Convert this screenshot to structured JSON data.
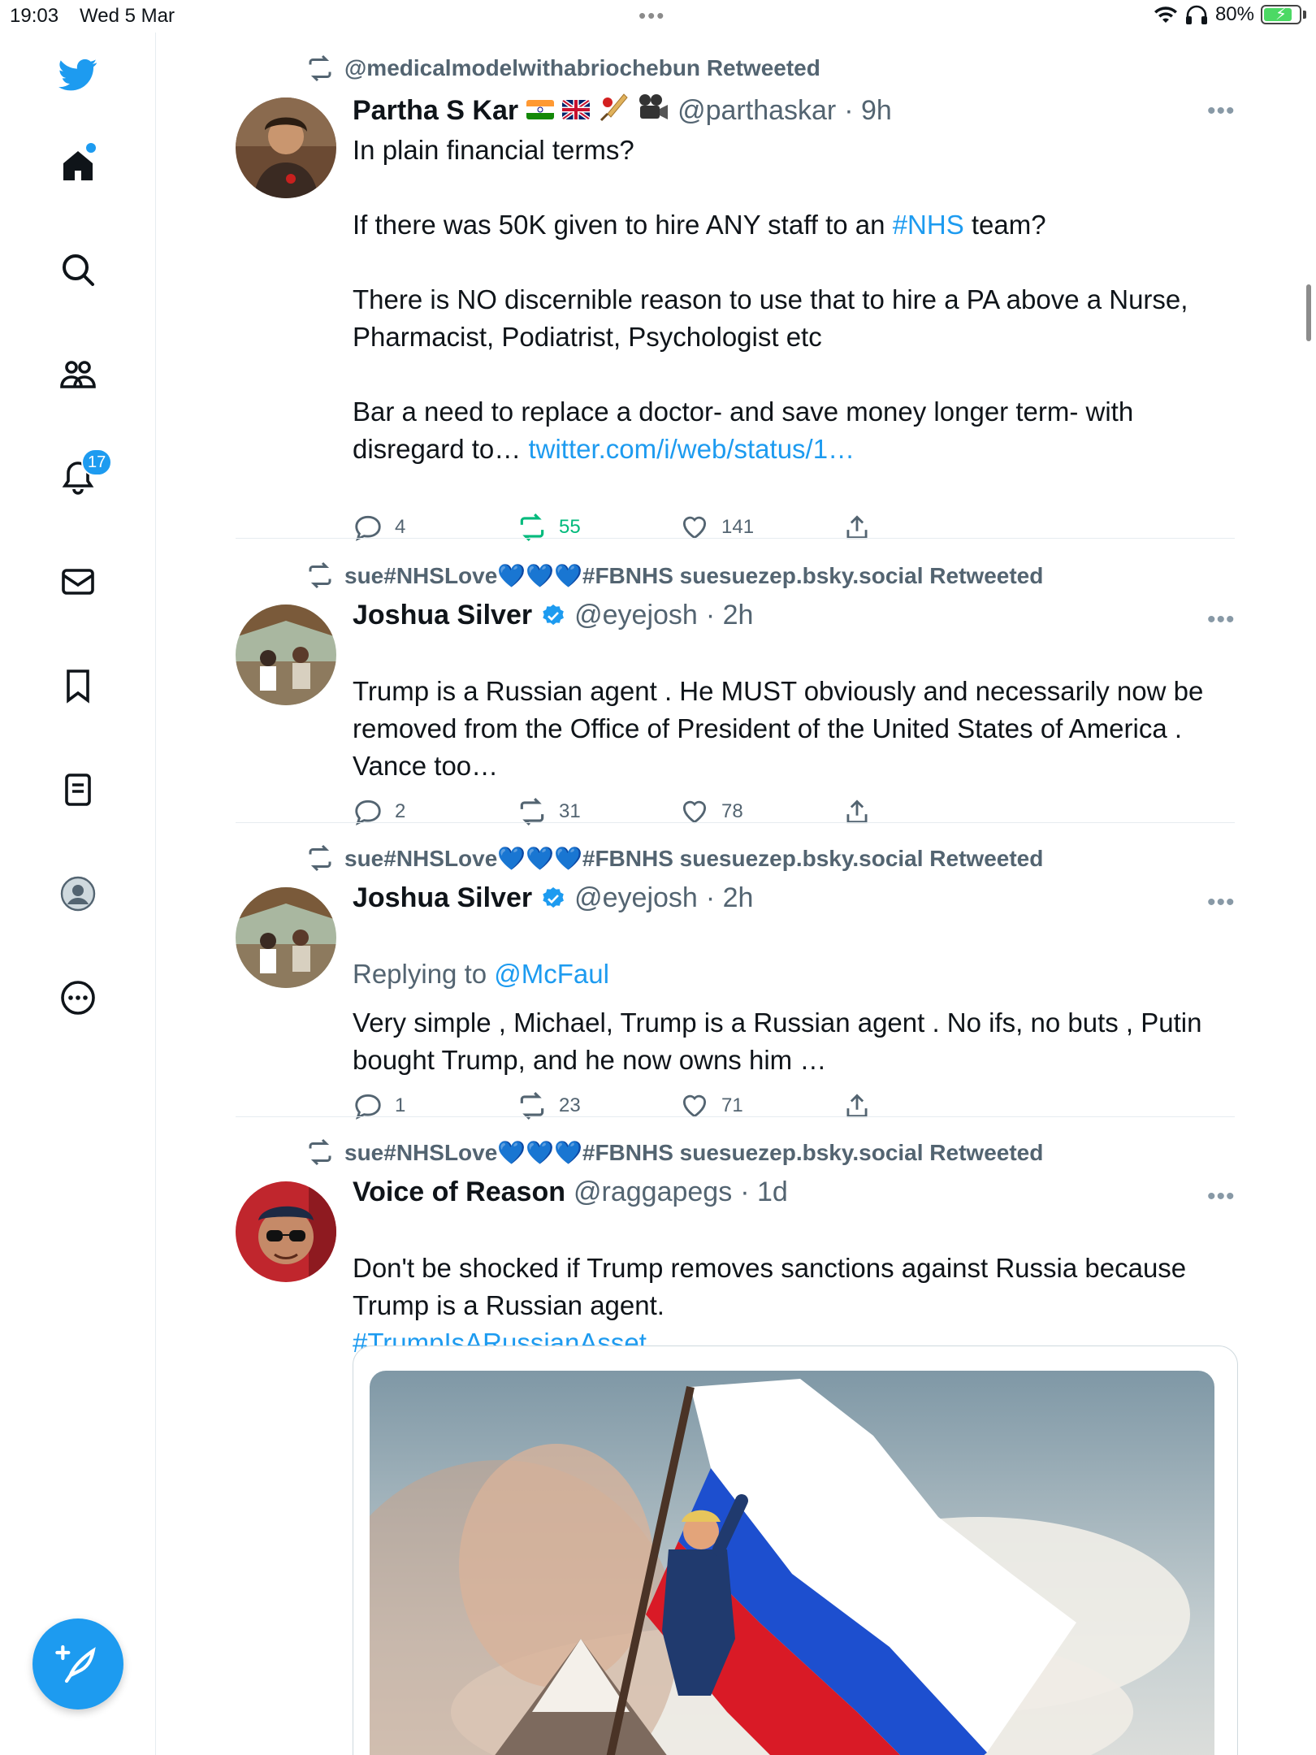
{
  "status_bar": {
    "time": "19:03",
    "date": "Wed 5 Mar",
    "battery": "80%",
    "battery_level": 0.8
  },
  "sidebar": {
    "items": [
      {
        "name": "twitter-logo-icon"
      },
      {
        "name": "home-icon"
      },
      {
        "name": "search-icon"
      },
      {
        "name": "communities-icon"
      },
      {
        "name": "notifications-icon",
        "badge": "17"
      },
      {
        "name": "messages-icon"
      },
      {
        "name": "bookmarks-icon"
      },
      {
        "name": "lists-icon"
      },
      {
        "name": "profile-icon"
      },
      {
        "name": "more-icon"
      }
    ],
    "compose_icon": "compose-icon"
  },
  "tweets": [
    {
      "retweeted_by": "@medicalmodelwithabriochebun Retweeted",
      "name": "Partha S Kar",
      "handle": "@parthaskar",
      "time": "· 9h",
      "body": [
        "In plain financial terms?",
        "",
        "If there was 50K given to hire ANY staff to an ",
        "team?",
        "",
        "There is NO discernible reason to use that to hire a PA above a Nurse, Pharmacist, Podiatrist, Psychologist etc",
        "",
        "Bar a need to replace a doctor- and save money longer term- with disregard to…"
      ],
      "hashtag": "#NHS",
      "link": "twitter.com/i/web/status/1…",
      "replies": "4",
      "retweets": "55",
      "likes": "141"
    },
    {
      "retweeted_by": "sue#NHSLove💙💙💙#FBNHS suesuezep.bsky.social Retweeted",
      "name": "Joshua Silver",
      "handle": "@eyejosh",
      "time": "· 2h",
      "body": "Trump is a Russian agent . He MUST obviously and necessarily now be removed from the Office of President of the United States of America . Vance too…",
      "replies": "2",
      "retweets": "31",
      "likes": "78"
    },
    {
      "retweeted_by": "sue#NHSLove💙💙💙#FBNHS suesuezep.bsky.social Retweeted",
      "name": "Joshua Silver",
      "handle": "@eyejosh",
      "time": "· 2h",
      "replying_label": "Replying to",
      "replying_to": "@McFaul",
      "body": "Very simple , Michael, Trump is a Russian agent . No ifs, no buts , Putin bought Trump, and he now owns him …",
      "replies": "1",
      "retweets": "23",
      "likes": "71"
    },
    {
      "retweeted_by": "sue#NHSLove💙💙💙#FBNHS suesuezep.bsky.social Retweeted",
      "name": "Voice of Reason",
      "handle": "@raggapegs",
      "time": "· 1d",
      "body": "Don't be shocked if Trump removes sanctions against Russia because Trump is a Russian agent.",
      "hashtag": "#TrumpIsARussianAsset"
    }
  ],
  "colors": {
    "accent": "#1d9bf0",
    "retweet_active": "#00ba7c",
    "muted": "#536471"
  }
}
